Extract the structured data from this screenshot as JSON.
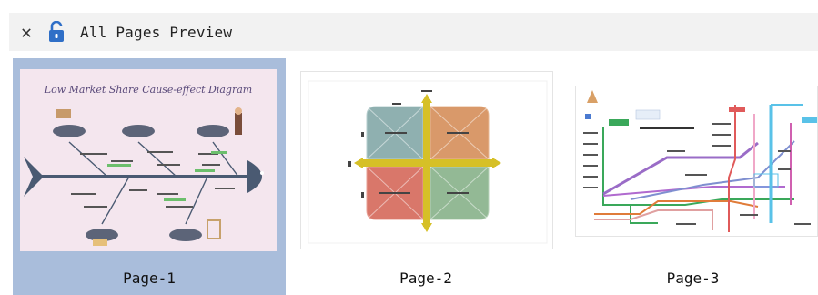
{
  "window": {
    "title": "All Pages Preview",
    "close_icon": "close-icon",
    "lock_icon": "lock-open-icon"
  },
  "pages": [
    {
      "label": "Page-1",
      "selected": true,
      "preview_title": "Low Market Share Cause-effect Diagram"
    },
    {
      "label": "Page-2",
      "selected": false
    },
    {
      "label": "Page-3",
      "selected": false
    }
  ],
  "colors": {
    "selected_bg": "#a9bddb",
    "fish": "#4a5a72",
    "quad_teal": "#8fb0b0",
    "quad_orange": "#d9996a",
    "quad_red": "#d9776a",
    "quad_green": "#93b995",
    "quad_axis": "#d6c027"
  }
}
